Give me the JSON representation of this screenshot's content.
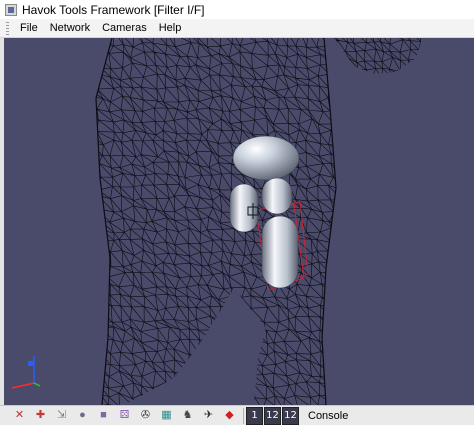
{
  "window": {
    "title": "Havok Tools Framework [Filter I/F]"
  },
  "menu": {
    "items": [
      "File",
      "Network",
      "Cameras",
      "Help"
    ]
  },
  "viewport": {
    "background_color": "#4a4a6a",
    "mesh_color": "#0c0c14",
    "collision_color": "#c8d0dc",
    "bounding_box_color": "#e02030"
  },
  "toolbar": {
    "tools": [
      {
        "name": "select-icon",
        "glyph": "✕"
      },
      {
        "name": "pick-icon",
        "glyph": "✚"
      },
      {
        "name": "drag-icon",
        "glyph": "⇲"
      },
      {
        "name": "sphere-icon",
        "glyph": "●"
      },
      {
        "name": "cube-icon",
        "glyph": "■"
      },
      {
        "name": "dice-icon",
        "glyph": "⚄"
      },
      {
        "name": "camera-icon",
        "glyph": "✇"
      },
      {
        "name": "grid-icon",
        "glyph": "▦"
      },
      {
        "name": "figure-icon",
        "glyph": "♞"
      },
      {
        "name": "bird-icon",
        "glyph": "✈"
      },
      {
        "name": "gem-icon",
        "glyph": "◆"
      }
    ],
    "viewport_buttons": [
      "1",
      "12",
      "12"
    ],
    "console_label": "Console"
  }
}
